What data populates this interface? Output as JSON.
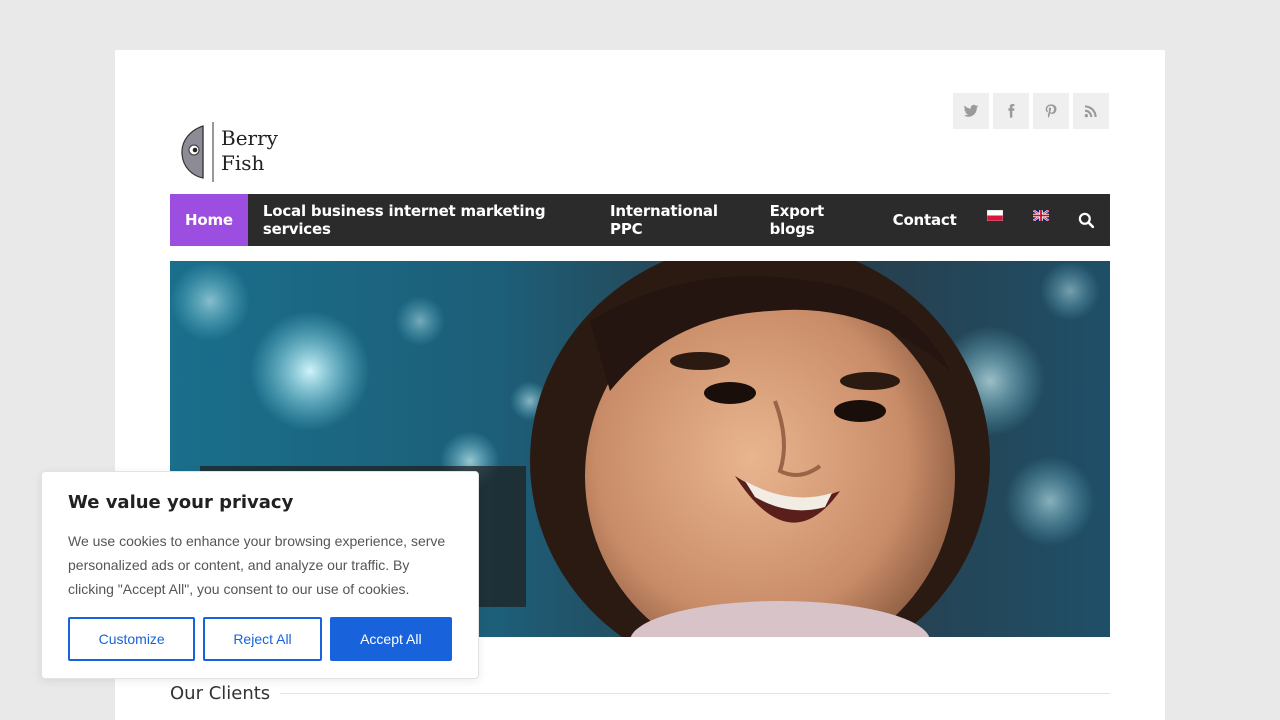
{
  "logo": {
    "line1": "Berry",
    "line2": "Fish"
  },
  "social": [
    {
      "icon": "twitter-icon"
    },
    {
      "icon": "facebook-icon"
    },
    {
      "icon": "pinterest-icon"
    },
    {
      "icon": "rss-icon"
    }
  ],
  "nav": {
    "items": [
      {
        "label": "Home",
        "active": true
      },
      {
        "label": "Local business internet marketing services"
      },
      {
        "label": "International PPC"
      },
      {
        "label": "Export blogs"
      },
      {
        "label": "Contact"
      }
    ],
    "flags": [
      "polish-flag-icon",
      "uk-flag-icon"
    ],
    "search_icon": "search-icon",
    "active_color": "#9b4ee0"
  },
  "clients": {
    "title": "Our Clients"
  },
  "cookie": {
    "title": "We value your privacy",
    "text": "We use cookies to enhance your browsing experience, serve personalized ads or content, and analyze our traffic. By clicking \"Accept All\", you consent to our use of cookies.",
    "customize": "Customize",
    "reject": "Reject All",
    "accept": "Accept All",
    "accent": "#1863dc"
  }
}
